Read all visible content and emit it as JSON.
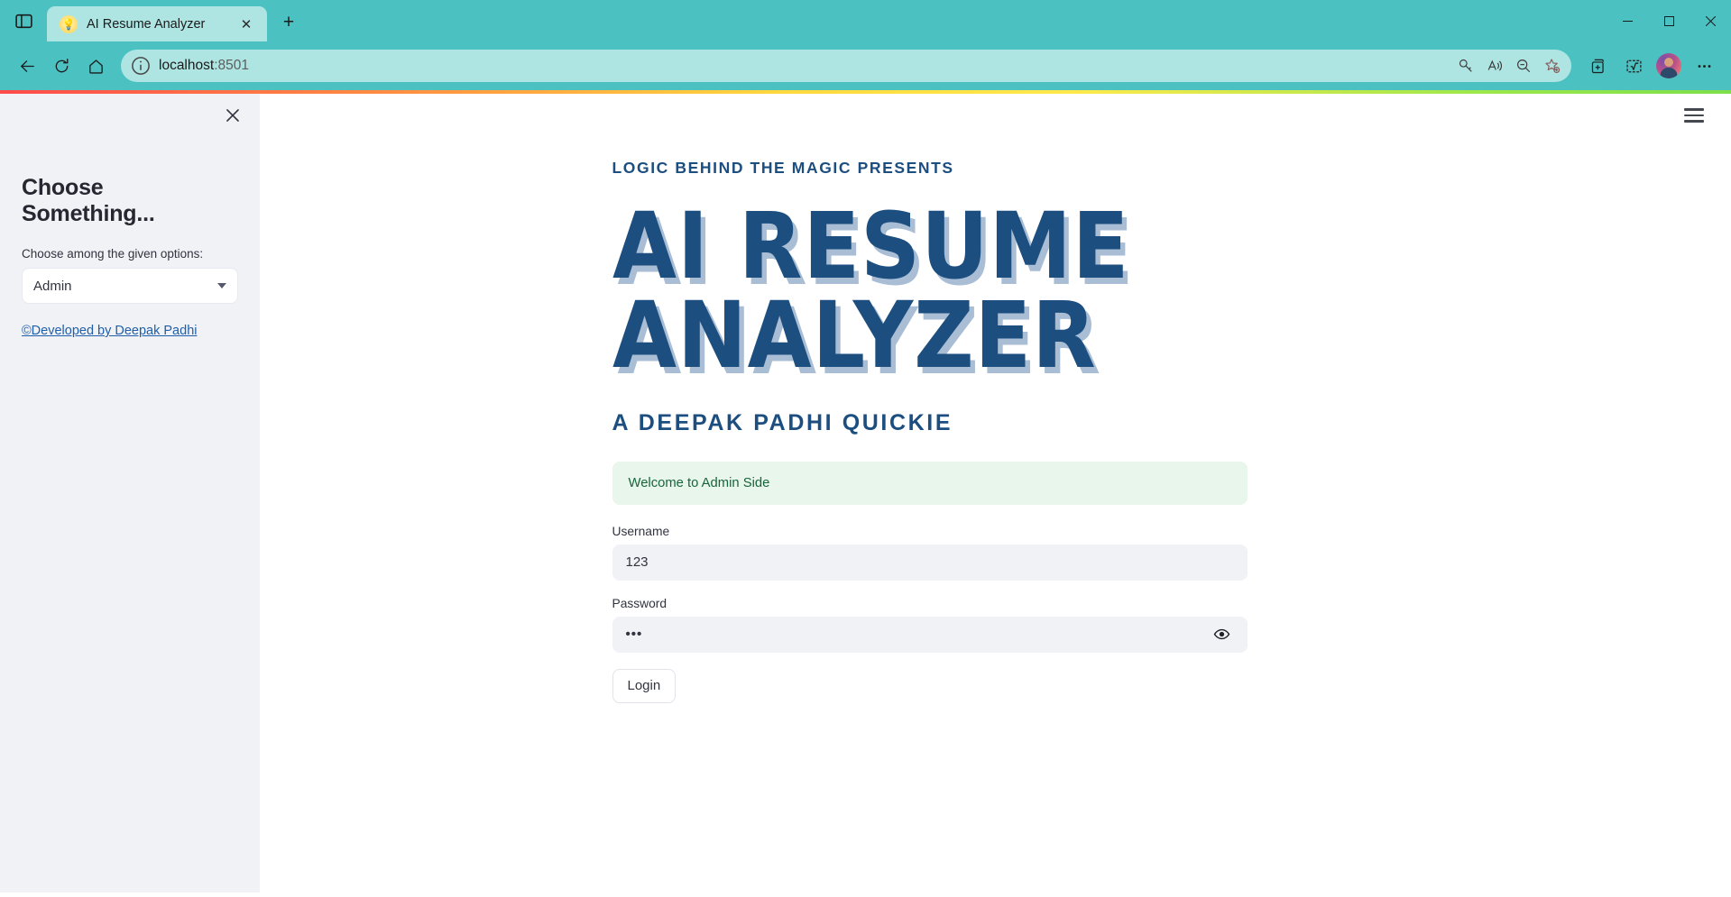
{
  "browser": {
    "sidebar_toggle_icon": "sidebar-panel-icon",
    "tab": {
      "favicon": "lightbulb-icon",
      "title": "AI Resume Analyzer",
      "close_icon": "close-icon"
    },
    "new_tab_label": "+",
    "window_controls": {
      "minimize": "minimize-icon",
      "maximize": "maximize-icon",
      "close": "close-icon"
    },
    "nav": {
      "back_icon": "back-arrow-icon",
      "refresh_icon": "refresh-icon",
      "home_icon": "home-icon"
    },
    "omnibox": {
      "info_icon": "info-circle-icon",
      "url_host": "localhost",
      "url_port": ":8501",
      "actions": [
        {
          "name": "password-key-icon",
          "label": "Saved passwords"
        },
        {
          "name": "read-aloud-icon",
          "label": "Read aloud"
        },
        {
          "name": "zoom-out-icon",
          "label": "Zoom"
        },
        {
          "name": "add-favorite-icon",
          "label": "Add to favorites"
        }
      ]
    },
    "toolbar": [
      {
        "name": "collections-icon",
        "label": "Collections"
      },
      {
        "name": "math-solver-icon",
        "label": "Math Solver"
      },
      {
        "name": "profile-avatar",
        "label": "Profile"
      },
      {
        "name": "settings-more-icon",
        "label": "Settings and more"
      }
    ]
  },
  "sidebar": {
    "close_icon": "close-icon",
    "title": "Choose Something...",
    "select_label": "Choose among the given options:",
    "select_value": "Admin",
    "select_caret_icon": "chevron-down-icon",
    "footer_link": "©Developed by Deepak Padhi"
  },
  "main": {
    "menu_icon": "hamburger-menu-icon",
    "kicker": "LOGIC BEHIND THE MAGIC PRESENTS",
    "hero_line1": "AI RESUME",
    "hero_line2": "ANALYZER",
    "subkicker": "A DEEPAK PADHI QUICKIE",
    "success_message": "Welcome to Admin Side",
    "username_label": "Username",
    "username_value": "123",
    "password_label": "Password",
    "password_value": "•••",
    "password_toggle_icon": "eye-icon",
    "login_button": "Login"
  },
  "colors": {
    "browser_accent": "#4bc1c1",
    "tab_active": "#aee5e2",
    "brand_blue": "#1c4e80",
    "brand_shadow": "#a9bdd4",
    "sidebar_bg": "#f0f2f6",
    "success_bg": "#e8f6ec",
    "success_text": "#17653a",
    "input_bg": "#f0f2f6",
    "link": "#1f5faa"
  }
}
